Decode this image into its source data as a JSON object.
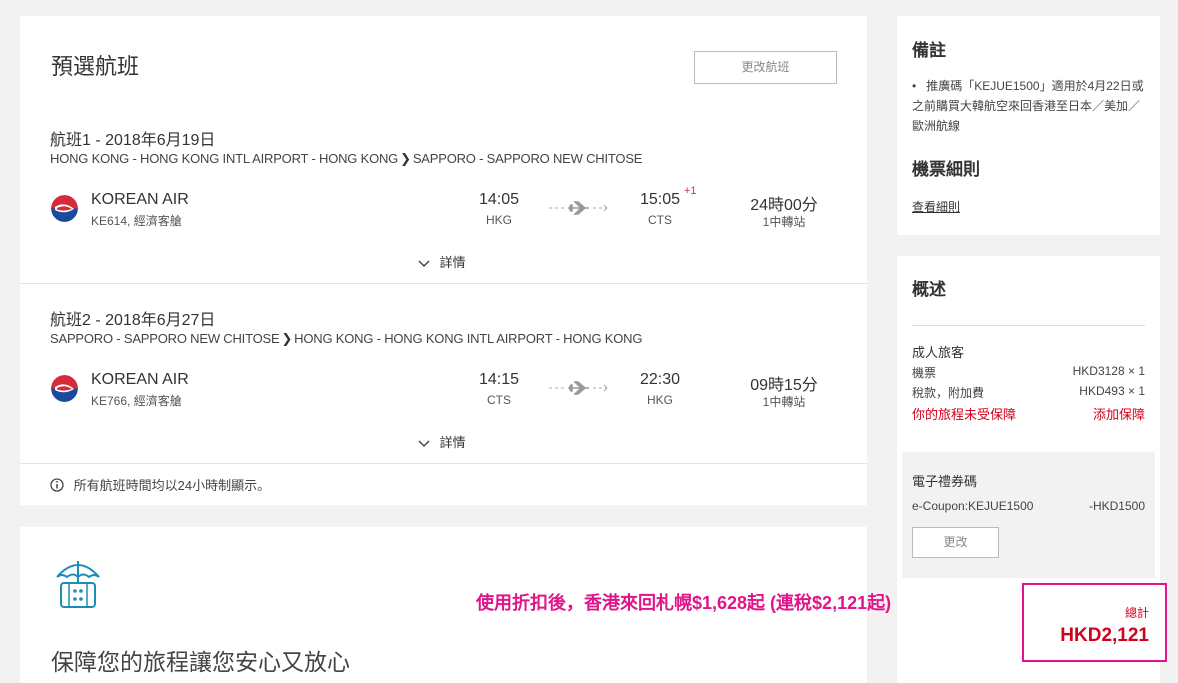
{
  "main": {
    "title": "預選航班",
    "change_flight_label": "更改航班",
    "segments": [
      {
        "title": "航班1 - 2018年6月19日",
        "route_from": "HONG KONG - HONG KONG INTL AIRPORT - HONG KONG",
        "route_to": "SAPPORO - SAPPORO NEW CHITOSE",
        "airline": "KOREAN AIR",
        "flight_info": "KE614, 經濟客艙",
        "depart_time": "14:05",
        "depart_code": "HKG",
        "arrive_time": "15:05",
        "arrive_day_offset": "+1",
        "arrive_code": "CTS",
        "duration": "24時00分",
        "stops": "1中轉站",
        "details_label": "詳情"
      },
      {
        "title": "航班2 - 2018年6月27日",
        "route_from": "SAPPORO - SAPPORO NEW CHITOSE",
        "route_to": "HONG KONG - HONG KONG INTL AIRPORT - HONG KONG",
        "airline": "KOREAN AIR",
        "flight_info": "KE766, 經濟客艙",
        "depart_time": "14:15",
        "depart_code": "CTS",
        "arrive_time": "22:30",
        "arrive_code": "HKG",
        "duration": "09時15分",
        "stops": "1中轉站",
        "details_label": "詳情"
      }
    ],
    "time_note": "所有航班時間均以24小時制顯示。"
  },
  "insurance": {
    "title": "保障您的旅程讓您安心又放心"
  },
  "notes": {
    "title": "備註",
    "bullet": "推廣碼「KEJUE1500」適用於4月22日或之前購買大韓航空來回香港至日本／美加／歐洲航線",
    "rules_title": "機票細則",
    "rules_link": "查看細則"
  },
  "summary": {
    "title": "概述",
    "adult_label": "成人旅客",
    "ticket_label": "機票",
    "ticket_value": "HKD3128 × 1",
    "tax_label": "稅款，附加費",
    "tax_value": "HKD493 × 1",
    "unprotected_label": "你的旅程未受保障",
    "add_protection_label": "添加保障",
    "coupon_title": "電子禮券碼",
    "coupon_code": "e-Coupon:KEJUE1500",
    "coupon_value": "-HKD1500",
    "coupon_change_label": "更改",
    "total_label": "總計",
    "total_value": "HKD2,121"
  },
  "promo_text": "使用折扣後，香港來回札幌$1,628起 (連稅$2,121起)",
  "colors": {
    "accent_red": "#d0021b",
    "highlight_pink": "#e0158a",
    "insurance_icon": "#1a8fb5"
  }
}
